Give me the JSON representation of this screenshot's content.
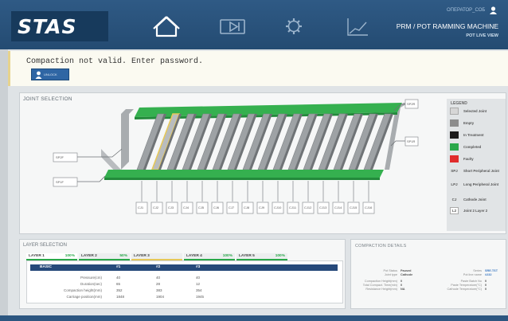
{
  "header": {
    "logo": "STAS",
    "user": "ОПЕРАТОР_СОБ",
    "machine_title": "PRM / POT RAMMING MACHINE",
    "view_label": "POT LIVE VIEW",
    "colors": {
      "bar": "#2c5680",
      "logo_block": "#173a5c"
    },
    "nav": [
      {
        "name": "home",
        "icon": "home-icon",
        "active": true
      },
      {
        "name": "video",
        "icon": "video-icon",
        "active": false
      },
      {
        "name": "settings",
        "icon": "gear-icon",
        "active": false
      },
      {
        "name": "chart",
        "icon": "chart-line-icon",
        "active": false
      }
    ]
  },
  "alert": {
    "message": "Compaction not valid. Enter password.",
    "button_label": "UNLOCK"
  },
  "joint_selection": {
    "title": "JOINT SELECTION",
    "left_tags": [
      "SP2F",
      "SP1F"
    ],
    "right_tags": [
      "SP2R",
      "SP1R"
    ],
    "bottom_tags": [
      "CJ1",
      "CJ2",
      "CJ3",
      "CJ4",
      "CJ5",
      "CJ6",
      "CJ7",
      "CJ8",
      "CJ9",
      "CJ10",
      "CJ11",
      "CJ12",
      "CJ13",
      "CJ14",
      "CJ15",
      "CJ16"
    ],
    "selected_block": 1
  },
  "legend": {
    "title": "LEGEND",
    "items": [
      {
        "label": "Selected Joint",
        "color": "#d6d6d6",
        "code": ""
      },
      {
        "label": "Empty",
        "color": "#8c8c8c",
        "code": ""
      },
      {
        "label": "In Treatment",
        "color": "#1c1c1c",
        "code": ""
      },
      {
        "label": "Completed",
        "color": "#2aa84a",
        "code": ""
      },
      {
        "label": "Faulty",
        "color": "#e02c2c",
        "code": ""
      },
      {
        "label": "Short Peripheral Joint",
        "color": "",
        "code": "SPJ"
      },
      {
        "label": "Long Peripheral Joint",
        "color": "",
        "code": "LPJ"
      },
      {
        "label": "Cathode Joint",
        "color": "",
        "code": "CJ"
      },
      {
        "label": "Joint 2 Layer 2",
        "color": "",
        "code": "L2"
      }
    ]
  },
  "layer_selection": {
    "title": "LAYER SELECTION",
    "tabs": [
      {
        "label": "LAYER 1",
        "pct": "100%",
        "underline": "#2aa84a"
      },
      {
        "label": "LAYER 2",
        "pct": "50%",
        "underline": "#2aa84a"
      },
      {
        "label": "LAYER 3",
        "pct": "",
        "underline": "#e6c85a"
      },
      {
        "label": "LAYER 4",
        "pct": "100%",
        "underline": "#2aa84a"
      },
      {
        "label": "LAYER 5",
        "pct": "100%",
        "underline": "#2aa84a"
      }
    ],
    "table": {
      "headers": [
        "BASIC",
        "#1",
        "#2",
        "#3"
      ],
      "rows": [
        {
          "label": "Pressure(cm)",
          "values": [
            "40",
            "40",
            "40"
          ]
        },
        {
          "label": "Duration(sec)",
          "values": [
            "65",
            "28",
            "12"
          ]
        },
        {
          "label": "Compaction height(mm)",
          "values": [
            "352",
            "383",
            "354"
          ]
        },
        {
          "label": "Carriage position(mm)",
          "values": [
            "1848",
            "1904",
            "1945"
          ]
        }
      ]
    }
  },
  "compaction": {
    "title": "COMPACTION DETAILS",
    "left": [
      {
        "label": "Pot Status",
        "value": "Paused"
      },
      {
        "label": "Joint type",
        "value": "Cathode"
      },
      {
        "label": "Compaction Height(mm)",
        "value": "0"
      },
      {
        "label": "Total Compact. Time(min)",
        "value": "0"
      },
      {
        "label": "Resistance Height(mm)",
        "value": "NA"
      }
    ],
    "right": [
      {
        "label": "Series",
        "value": "SRE.TST"
      },
      {
        "label": "Pot line name",
        "value": "#232"
      },
      {
        "label": "Paste Batch No",
        "value": "0"
      },
      {
        "label": "Paste Temperature(°C)",
        "value": "0"
      },
      {
        "label": "Cathode Temperature(°C)",
        "value": "0"
      }
    ]
  }
}
